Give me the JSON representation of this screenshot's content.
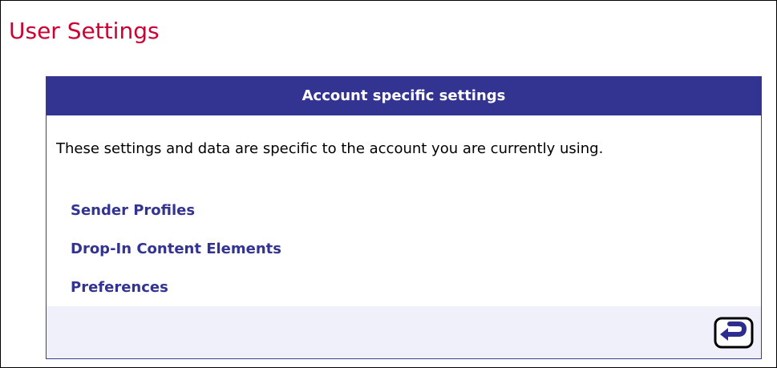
{
  "page": {
    "title": "User Settings"
  },
  "panel": {
    "header": "Account specific settings",
    "description": "These settings and data are specific to the account you are currently using.",
    "links": [
      {
        "label": "Sender Profiles"
      },
      {
        "label": "Drop-In Content Elements"
      },
      {
        "label": "Preferences"
      }
    ],
    "footer": {
      "back_icon": "return-arrow-icon"
    }
  },
  "colors": {
    "title": "#cc0033",
    "header_bg": "#333391",
    "header_text": "#ffffff",
    "link": "#333391",
    "footer_bg": "#f0f0fb",
    "border": "#3b3d8f"
  }
}
